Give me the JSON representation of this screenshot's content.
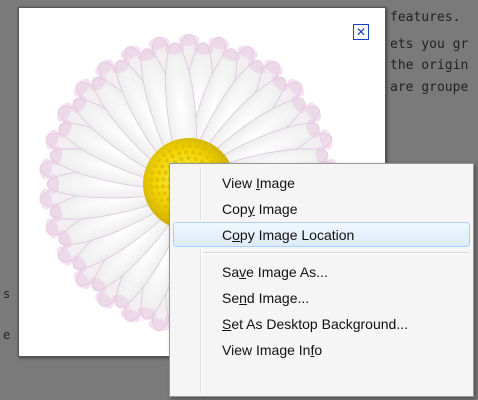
{
  "background": {
    "lines": [
      "features. ",
      "ets you gr",
      " the origin",
      "are groupe"
    ],
    "fragments": [
      "s",
      "e"
    ]
  },
  "lightbox": {
    "close_glyph": "✕",
    "accent": "#1a3fbf"
  },
  "context_menu": {
    "items": [
      {
        "label": "View Image",
        "mnemonic": "I"
      },
      {
        "label": "Copy Image",
        "mnemonic": "y"
      },
      {
        "label": "Copy Image Location",
        "mnemonic": "o",
        "highlighted": true
      },
      {
        "label": "Save Image As...",
        "mnemonic": "v"
      },
      {
        "label": "Send Image...",
        "mnemonic": "n"
      },
      {
        "label": "Set As Desktop Background...",
        "mnemonic": "S"
      },
      {
        "label": "View Image Info",
        "mnemonic": "f"
      }
    ],
    "highlight_color": "#dcebfa"
  }
}
